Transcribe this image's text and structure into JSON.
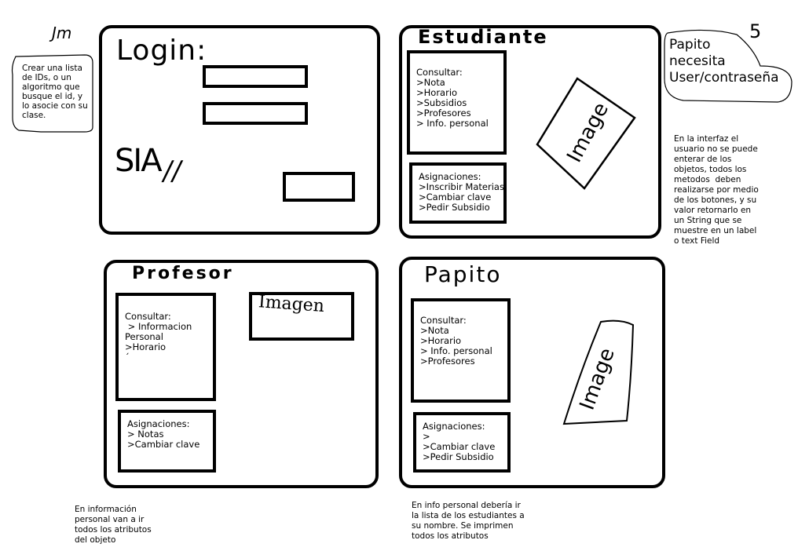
{
  "top_left_initials": "Jm",
  "top_right_number": "5",
  "left_bubble": [
    "Crear una lista",
    "de IDs, o un",
    "algoritmo que",
    "busque el id, y",
    "lo asocie con su",
    "clase."
  ],
  "right_bubble": [
    "Papito",
    "necesita",
    "User/contraseña"
  ],
  "right_note": [
    "En la interfaz el",
    "usuario no se puede",
    "enterar de los",
    "objetos, todos los",
    "metodos  deben",
    "realizarse por medio",
    "de los botones, y su",
    "valor retornarlo en",
    "un String que se",
    "muestre en un label",
    "o text Field"
  ],
  "login": {
    "title": "Login:",
    "logo": "SIA",
    "logo_marks": "//"
  },
  "estudiante": {
    "title": "Estudiante",
    "consultar": [
      "Consultar:",
      "",
      ">Nota",
      ">Horario",
      ">Subsidios",
      ">Profesores",
      "> Info. personal"
    ],
    "asignaciones": [
      "Asignaciones:",
      ">Inscribir Materias",
      ">Cambiar clave",
      ">Pedir Subsidio"
    ],
    "image_label": "Image"
  },
  "profesor": {
    "title": "Profesor",
    "consultar": [
      "Consultar:",
      " > Informacion",
      "Personal",
      ">Horario",
      "´"
    ],
    "asignaciones": [
      "Asignaciones:",
      "> Notas",
      ">Cambiar clave"
    ],
    "image_label": "Imagen"
  },
  "papito": {
    "title": "Papito",
    "consultar": [
      "Consultar:",
      "",
      ">Nota",
      ">Horario",
      "> Info. personal",
      ">Profesores"
    ],
    "asignaciones": [
      "Asignaciones:",
      ">",
      ">Cambiar clave",
      ">Pedir Subsidio"
    ],
    "image_label": "Image"
  },
  "bottom_left_note": [
    "En información",
    "personal van a ir",
    "todos los atributos",
    "del objeto"
  ],
  "bottom_right_note": [
    "En info personal debería ir",
    "la lista de los estudiantes a",
    "su nombre. Se imprimen",
    "todos los atributos"
  ]
}
